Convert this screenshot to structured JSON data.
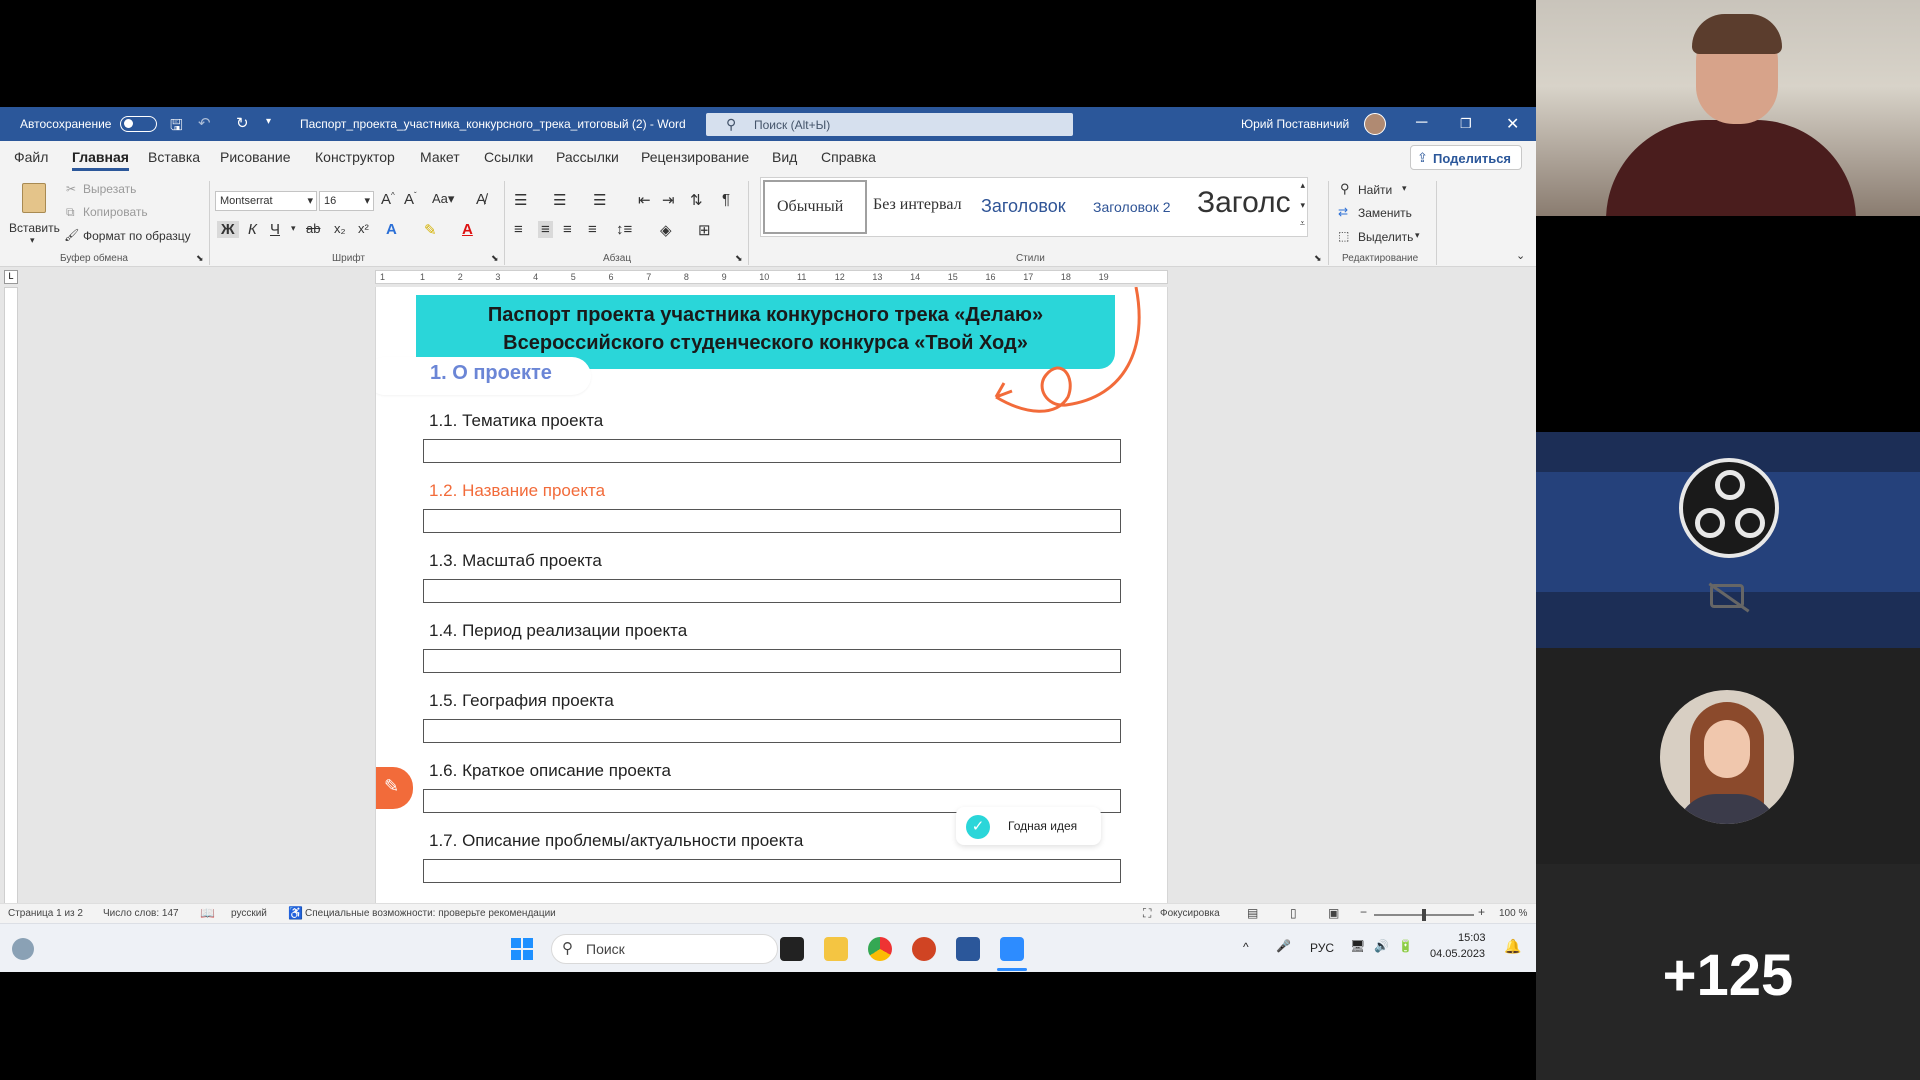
{
  "titlebar": {
    "autosave_label": "Автосохранение",
    "doc_title": "Паспорт_проекта_участника_конкурсного_трека_итоговый (2)  -  Word",
    "search_placeholder": "Поиск (Alt+Ы)",
    "user_name": "Юрий Поставничий"
  },
  "tabs": [
    "Файл",
    "Главная",
    "Вставка",
    "Рисование",
    "Конструктор",
    "Макет",
    "Ссылки",
    "Рассылки",
    "Рецензирование",
    "Вид",
    "Справка"
  ],
  "share_label": "Поделиться",
  "ribbon": {
    "clipboard": {
      "paste": "Вставить",
      "cut": "Вырезать",
      "copy": "Копировать",
      "format_painter": "Формат по образцу",
      "group": "Буфер обмена"
    },
    "font": {
      "name": "Montserrat",
      "size": "16",
      "group": "Шрифт"
    },
    "paragraph": {
      "group": "Абзац"
    },
    "styles": {
      "items": [
        "Обычный",
        "Без интервал",
        "Заголовок",
        "Заголовок 2",
        "Заголс"
      ],
      "group": "Стили"
    },
    "editing": {
      "find": "Найти",
      "replace": "Заменить",
      "select": "Выделить",
      "group": "Редактирование"
    }
  },
  "ruler_ticks": [
    "1",
    "1",
    "2",
    "3",
    "4",
    "5",
    "6",
    "7",
    "8",
    "9",
    "10",
    "11",
    "12",
    "13",
    "14",
    "15",
    "16",
    "17",
    "18",
    "19"
  ],
  "document": {
    "banner_line1": "Паспорт проекта участника конкурсного трека «Делаю»",
    "banner_line2": "Всероссийского студенческого конкурса «Твой Ход»",
    "section_title": "1. О проекте",
    "items": [
      "1.1. Тематика проекта",
      "1.2. Название проекта",
      "1.3. Масштаб проекта",
      "1.4. Период реализации проекта",
      "1.5. География проекта",
      "1.6. Краткое описание проекта",
      "1.7. Описание проблемы/актуальности проекта"
    ],
    "toast_label": "Годная идея"
  },
  "statusbar": {
    "page": "Страница 1 из 2",
    "words": "Число слов: 147",
    "language": "русский",
    "accessibility": "Специальные возможности: проверьте рекомендации",
    "focus": "Фокусировка",
    "zoom": "100 %"
  },
  "taskbar": {
    "search": "Поиск",
    "lang": "РУС",
    "time": "15:03",
    "date": "04.05.2023"
  },
  "participants": {
    "more_count": "+125"
  },
  "colors": {
    "word_blue": "#2b579a",
    "banner_cyan": "#2ad6d9",
    "accent_orange": "#f26b3a",
    "section_blue": "#6b86d6"
  }
}
